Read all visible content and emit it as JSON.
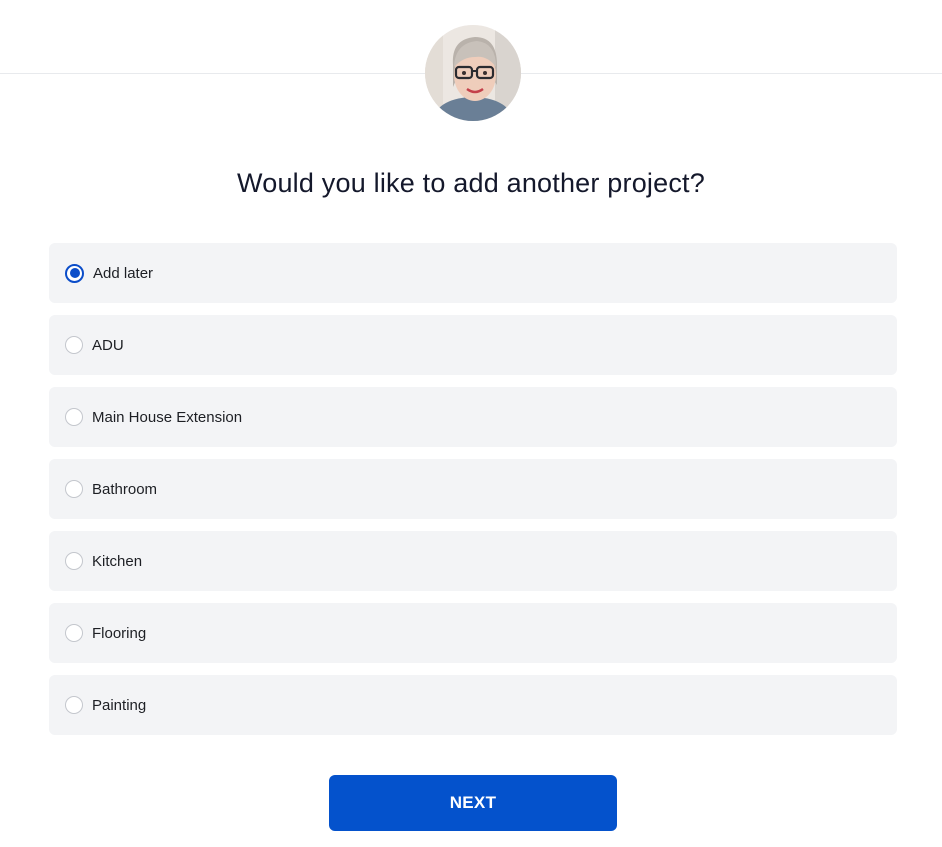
{
  "header": {
    "avatar_icon": "user-avatar-photo"
  },
  "main": {
    "question": "Would you like to add another project?",
    "options": [
      {
        "label": "Add later",
        "selected": true
      },
      {
        "label": "ADU",
        "selected": false
      },
      {
        "label": "Main House Extension",
        "selected": false
      },
      {
        "label": "Bathroom",
        "selected": false
      },
      {
        "label": "Kitchen",
        "selected": false
      },
      {
        "label": "Flooring",
        "selected": false
      },
      {
        "label": "Painting",
        "selected": false
      }
    ],
    "next_label": "NEXT"
  },
  "colors": {
    "accent": "#0452cc",
    "radio_selected": "#0b4dc9",
    "option_background": "#f3f4f6",
    "heading_text": "#14182b"
  }
}
